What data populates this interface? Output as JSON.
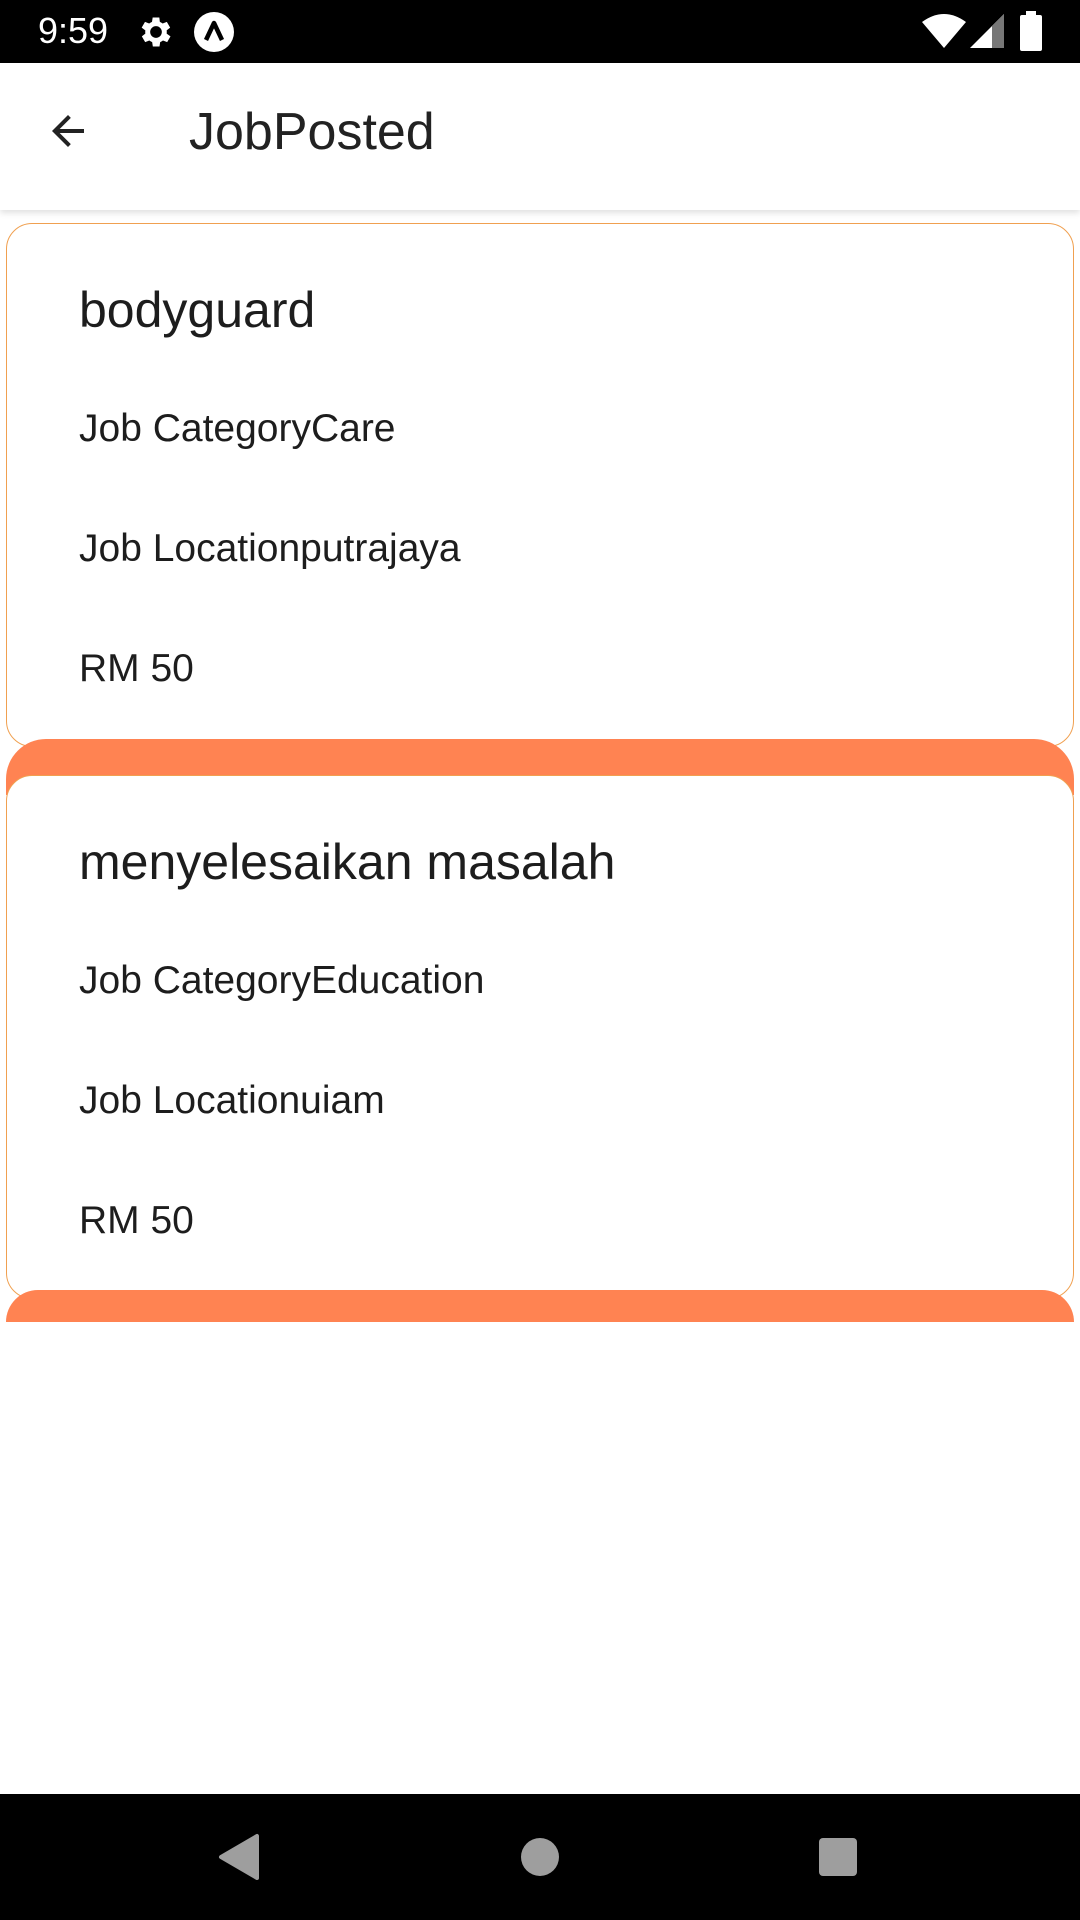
{
  "status_bar": {
    "time": "9:59",
    "left_icons": [
      "settings-icon",
      "app-notification-icon"
    ],
    "right_icons": [
      "wifi-icon",
      "cellular-signal-icon",
      "battery-icon"
    ]
  },
  "app_bar": {
    "back_icon": "arrow-back-icon",
    "title": "JobPosted"
  },
  "jobs": [
    {
      "title": "bodyguard",
      "category_line": "Job CategoryCare",
      "location_line": "Job Locationputrajaya",
      "pay": "RM 50"
    },
    {
      "title": "menyelesaikan masalah",
      "category_line": "Job CategoryEducation",
      "location_line": "Job Locationuiam",
      "pay": "RM 50"
    }
  ],
  "nav_bar": {
    "buttons": [
      "back-triangle-icon",
      "home-circle-icon",
      "recents-square-icon"
    ]
  },
  "colors": {
    "accent": "#ff8352",
    "card_border": "#f0a050",
    "status_bar": "#000000",
    "text": "#1d1d1d"
  }
}
